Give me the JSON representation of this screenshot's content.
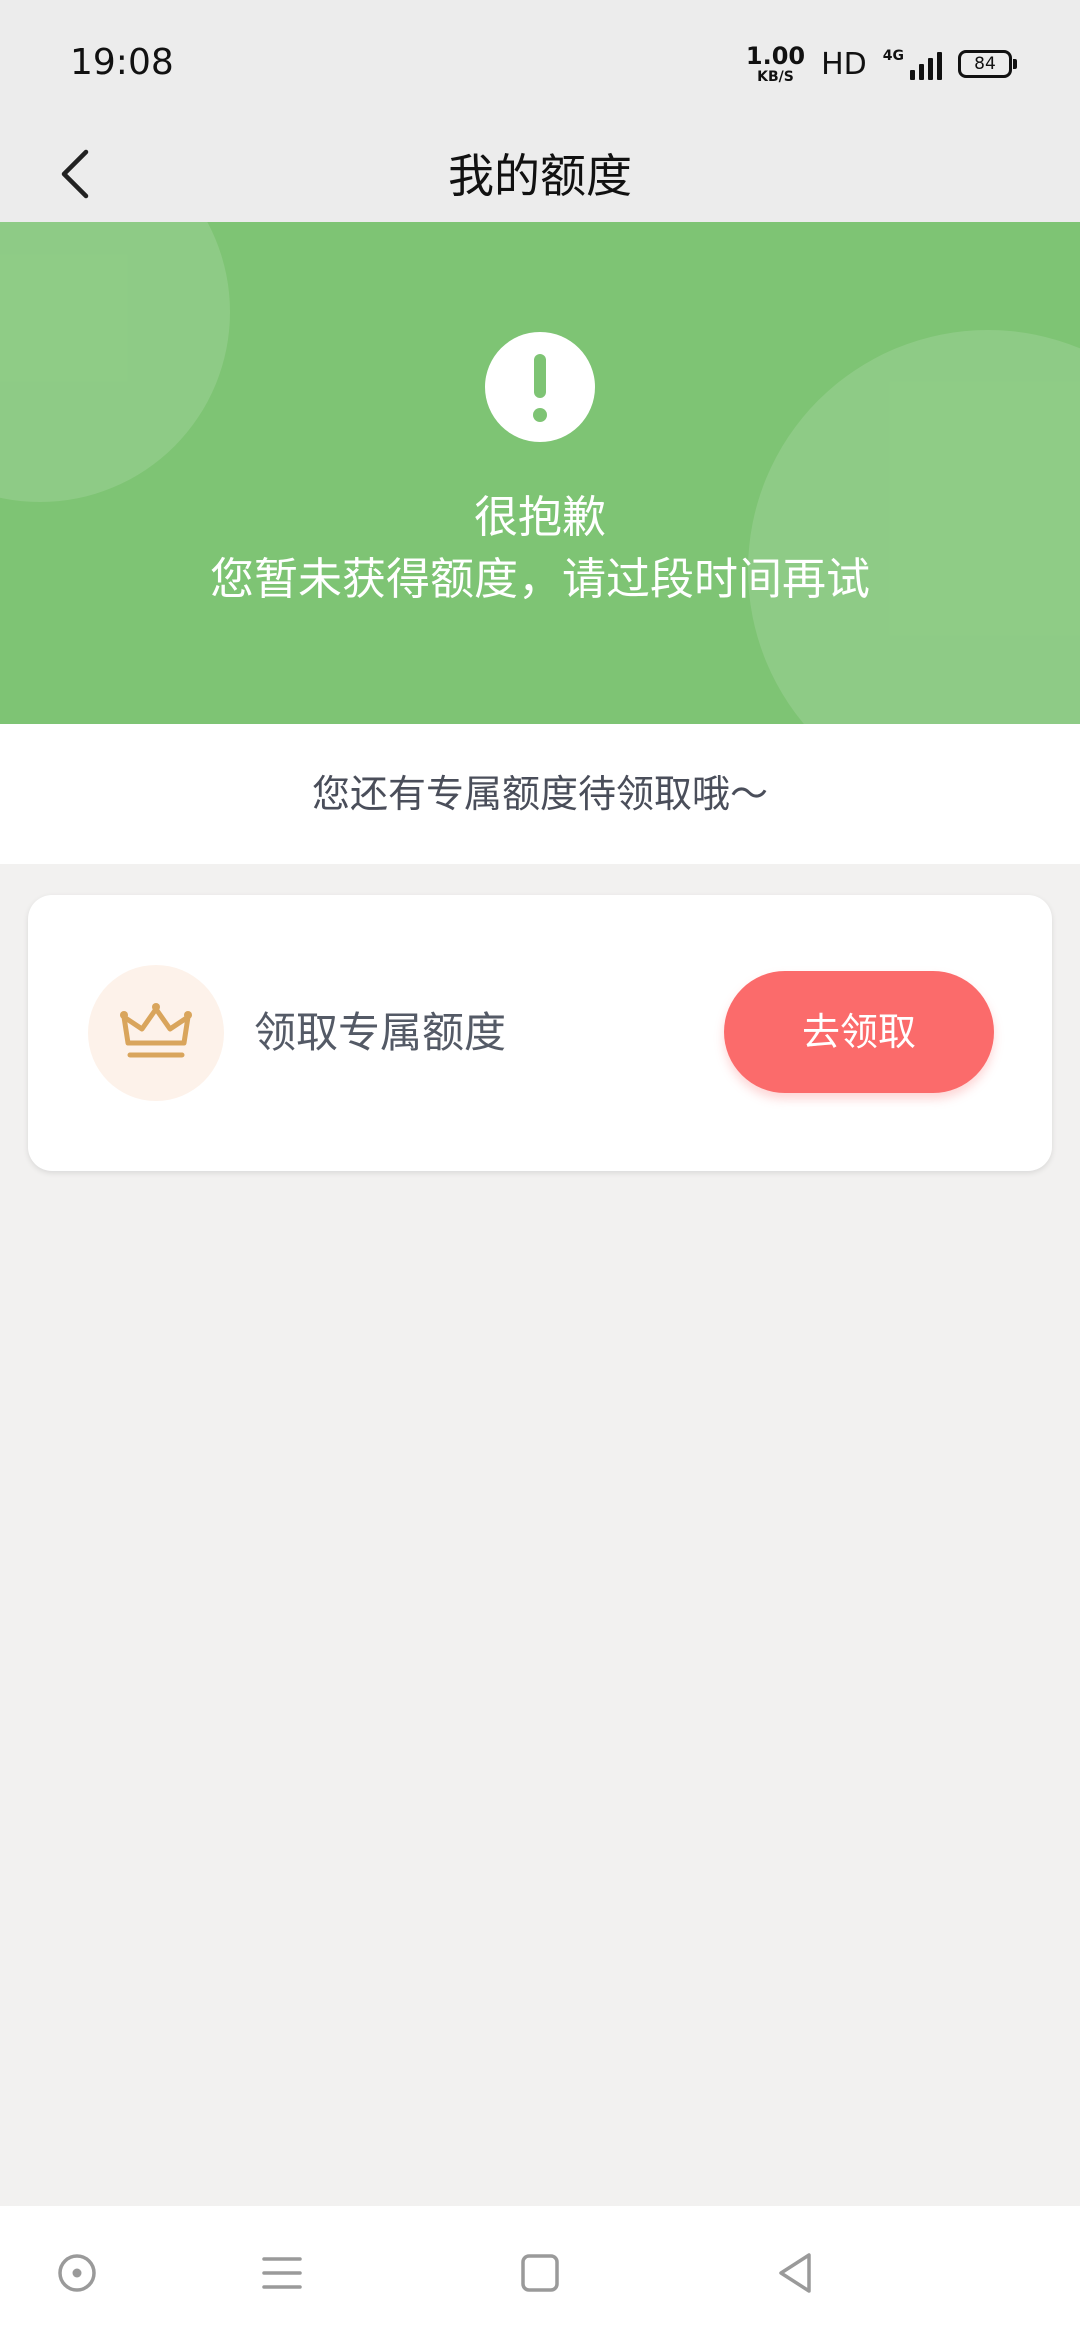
{
  "status_bar": {
    "time": "19:08",
    "speed_value": "1.00",
    "speed_unit": "KB/S",
    "hd": "HD",
    "network": "4G",
    "battery": "84"
  },
  "header": {
    "title": "我的额度",
    "back_icon": "chevron-left-icon"
  },
  "banner": {
    "title": "很抱歉",
    "message": "您暂未获得额度，请过段时间再试",
    "icon": "exclamation-icon",
    "color": "#7ec474"
  },
  "pending": {
    "text": "您还有专属额度待领取哦～"
  },
  "offer_card": {
    "icon": "crown-icon",
    "label": "领取专属额度",
    "button_label": "去领取",
    "button_color": "#fb6b6b",
    "icon_color": "#d9a55c"
  },
  "nav_bar": {
    "items": [
      "circle-dot-icon",
      "menu-icon",
      "square-icon",
      "back-triangle-icon"
    ]
  }
}
